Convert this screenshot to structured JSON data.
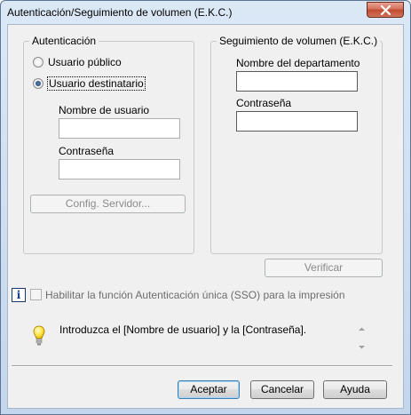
{
  "window": {
    "title": "Autenticación/Seguimiento de volumen (E.K.C.)"
  },
  "auth": {
    "group_label": "Autenticación",
    "radio_public": "Usuario público",
    "radio_dest": "Usuario destinatario",
    "selected": "Usuario destinatario",
    "username_label": "Nombre de usuario",
    "username_value": "",
    "password_label": "Contraseña",
    "password_value": "",
    "server_button": "Config. Servidor..."
  },
  "ekc": {
    "group_label": "Seguimiento de volumen (E.K.C.)",
    "dept_label": "Nombre del departamento",
    "dept_value": "",
    "password_label": "Contraseña",
    "password_value": "",
    "verify_button": "Verificar"
  },
  "sso": {
    "checkbox_label": "Habilitar la función Autenticación única (SSO) para la impresión",
    "checked": false
  },
  "message": {
    "text": "Introduzca el [Nombre de usuario] y la [Contraseña]."
  },
  "footer": {
    "ok": "Aceptar",
    "cancel": "Cancelar",
    "help": "Ayuda"
  },
  "icons": {
    "close": "close-icon",
    "info": "info-icon",
    "hint": "lightbulb-icon"
  },
  "colors": {
    "title_bar": "#c4d6ec",
    "dialog_bg": "#f0f0f0",
    "close_button": "#c04a31",
    "default_button_border": "#3c7fb1"
  }
}
